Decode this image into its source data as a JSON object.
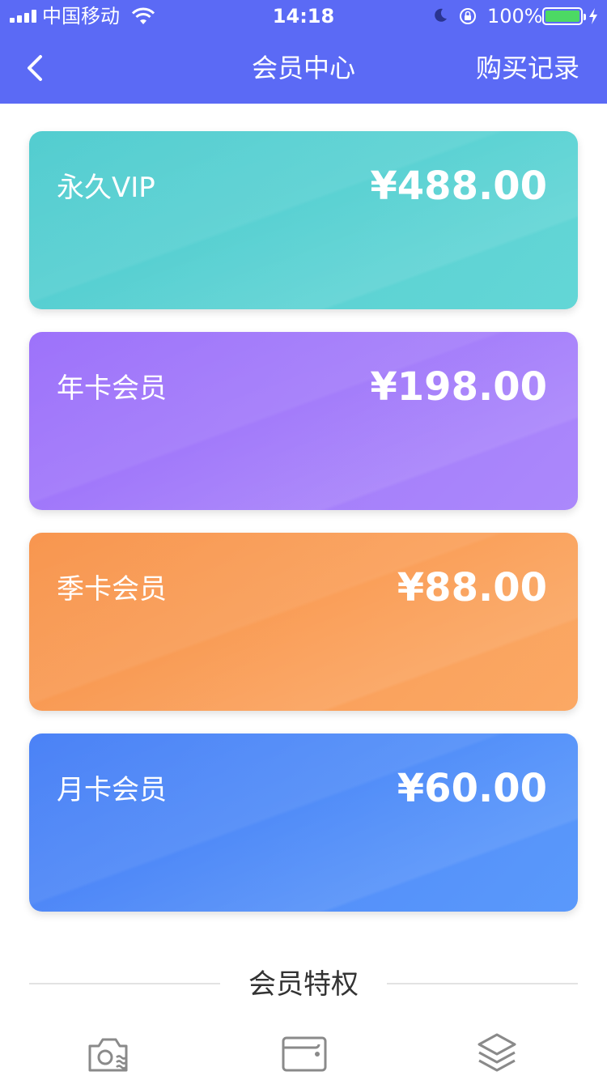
{
  "status_bar": {
    "carrier": "中国移动",
    "time": "14:18",
    "battery_percent": "100%",
    "battery_level": 1.0,
    "icons": [
      "signal-icon",
      "wifi-icon",
      "moon-icon",
      "rotation-lock-icon",
      "battery-icon",
      "charging-icon"
    ]
  },
  "nav": {
    "back_icon": "chevron-left-icon",
    "title": "会员中心",
    "right_action": "购买记录"
  },
  "cards": [
    {
      "name": "永久VIP",
      "price": "¥488.00",
      "color": "#53cdd0"
    },
    {
      "name": "年卡会员",
      "price": "¥198.00",
      "color": "#9d72fa"
    },
    {
      "name": "季卡会员",
      "price": "¥88.00",
      "color": "#f8964f"
    },
    {
      "name": "月卡会员",
      "price": "¥60.00",
      "color": "#4b82f6"
    }
  ],
  "privileges": {
    "title": "会员特权",
    "icons": [
      "camera-wave-icon",
      "wallet-icon",
      "layers-icon"
    ]
  },
  "colors": {
    "header": "#5b6af5",
    "divider": "#e2e2e2",
    "icon_gray": "#8a8a8a"
  }
}
